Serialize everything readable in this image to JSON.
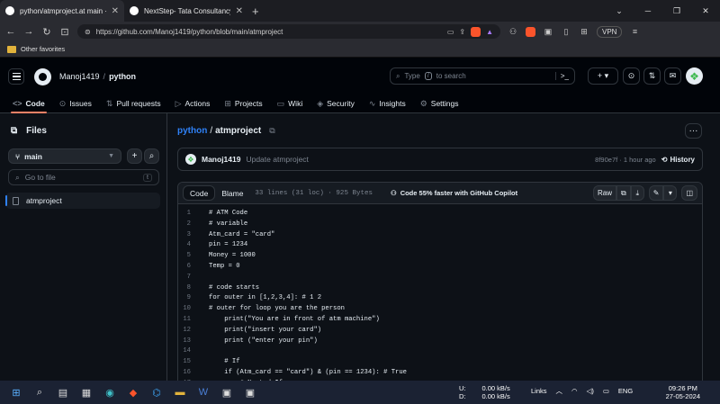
{
  "browser": {
    "tabs": [
      {
        "title": "python/atmproject.at main · Ma",
        "active": true
      },
      {
        "title": "NextStep- Tata Consultancy Services",
        "active": false
      }
    ],
    "url": "https://github.com/Manoj1419/python/blob/main/atmproject",
    "vpn_label": "VPN",
    "bookmark": "Other favorites"
  },
  "header": {
    "owner": "Manoj1419",
    "separator": "/",
    "repo": "python",
    "search_prefix": "Type",
    "search_key": "/",
    "search_suffix": "to search",
    "search_cmd": ">_"
  },
  "repo_tabs": [
    {
      "label": "Code",
      "icon": "<>"
    },
    {
      "label": "Issues",
      "icon": "⊙"
    },
    {
      "label": "Pull requests",
      "icon": "⇅"
    },
    {
      "label": "Actions",
      "icon": "▷"
    },
    {
      "label": "Projects",
      "icon": "⊞"
    },
    {
      "label": "Wiki",
      "icon": "▭"
    },
    {
      "label": "Security",
      "icon": "◈"
    },
    {
      "label": "Insights",
      "icon": "∿"
    },
    {
      "label": "Settings",
      "icon": "⚙"
    }
  ],
  "sidebar": {
    "title": "Files",
    "branch": "main",
    "goto_placeholder": "Go to file",
    "goto_key": "t",
    "file": "atmproject"
  },
  "file": {
    "path_repo": "python",
    "path_sep": "/",
    "path_file": "atmproject",
    "commit_author": "Manoj1419",
    "commit_message": "Update atmproject",
    "commit_meta": "8f90e7f · 1 hour ago",
    "history_label": "History",
    "tab_code": "Code",
    "tab_blame": "Blame",
    "stats": "33 lines (31 loc) · 925 Bytes",
    "copilot": "Code 55% faster with GitHub Copilot",
    "raw_label": "Raw"
  },
  "code_lines": [
    {
      "n": "1",
      "t": "# ATM Code"
    },
    {
      "n": "2",
      "t": "# variable"
    },
    {
      "n": "3",
      "t": "Atm_card = \"card\""
    },
    {
      "n": "4",
      "t": "pin = 1234"
    },
    {
      "n": "5",
      "t": "Money = 1000"
    },
    {
      "n": "6",
      "t": "Temp = 0"
    },
    {
      "n": "7",
      "t": ""
    },
    {
      "n": "8",
      "t": "# code starts"
    },
    {
      "n": "9",
      "t": "for outer in [1,2,3,4]: # 1 2"
    },
    {
      "n": "10",
      "t": "# outer for loop you are the person"
    },
    {
      "n": "11",
      "t": "    print(\"You are in front of atm machine\")"
    },
    {
      "n": "12",
      "t": "    print(\"insert your card\")"
    },
    {
      "n": "13",
      "t": "    print (\"enter your pin\")"
    },
    {
      "n": "14",
      "t": ""
    },
    {
      "n": "15",
      "t": "    # If"
    },
    {
      "n": "16",
      "t": "    if (Atm_card == \"card\") & (pin == 1234): # True"
    },
    {
      "n": "17",
      "t": "        # Nested If"
    }
  ],
  "taskbar": {
    "up_label": "U:",
    "up_value": "0.00 kB/s",
    "down_label": "D:",
    "down_value": "0.00 kB/s",
    "links": "Links",
    "lang": "ENG",
    "time": "09:26 PM",
    "date": "27-05-2024"
  }
}
